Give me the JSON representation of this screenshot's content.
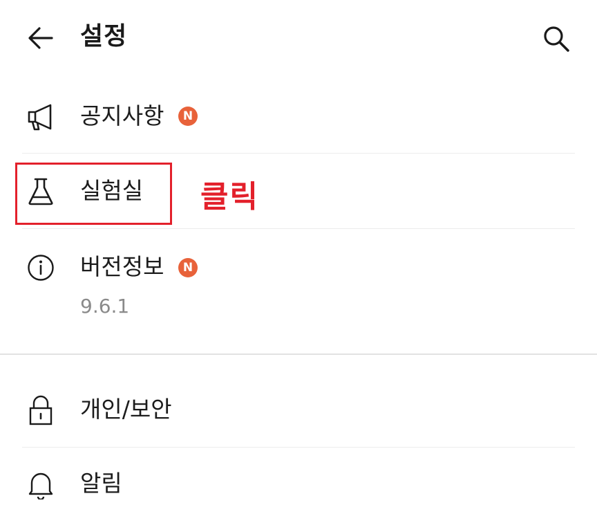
{
  "header": {
    "title": "설정",
    "back_icon": "arrow-left-icon",
    "search_icon": "search-icon"
  },
  "menu": {
    "notice": {
      "icon": "megaphone-icon",
      "label": "공지사항",
      "badge": "N"
    },
    "lab": {
      "icon": "flask-icon",
      "label": "실험실"
    },
    "version": {
      "icon": "info-icon",
      "label": "버전정보",
      "badge": "N",
      "value": "9.6.1"
    },
    "privacy": {
      "icon": "lock-icon",
      "label": "개인/보안"
    },
    "alerts": {
      "icon": "bell-icon",
      "label": "알림"
    }
  },
  "annotation": {
    "text": "클릭",
    "color": "#e3202b"
  },
  "colors": {
    "badge": "#e8623a",
    "highlight": "#e3202b",
    "text": "#1c1c1c",
    "muted": "#8a8a8a"
  }
}
